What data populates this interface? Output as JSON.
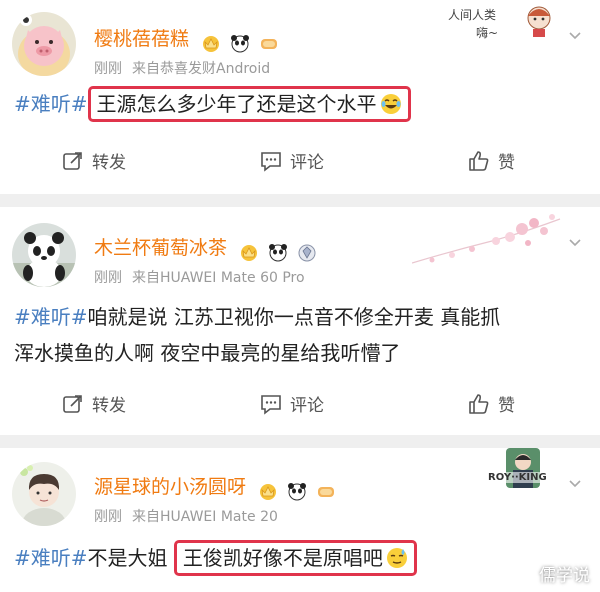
{
  "posts": [
    {
      "username": "樱桃蓓蓓糕",
      "time": "刚刚",
      "source": "来自恭喜发财Android",
      "content": {
        "hashtag": "#难听#",
        "highlight": "王源怎么多少年了还是这个水平",
        "emoji": "laugh-cry-emoji"
      },
      "decoration_text": [
        "人间人类",
        "嗨~"
      ],
      "actions": {
        "repost": "转发",
        "comment": "评论",
        "like": "赞"
      }
    },
    {
      "username": "木兰杯葡萄冰茶",
      "time": "刚刚",
      "source": "来自HUAWEI Mate 60 Pro",
      "content": {
        "hashtag": "#难听#",
        "line1": "咱就是说 江苏卫视你一点音不修全开麦 真能抓",
        "line2": "浑水摸鱼的人啊 夜空中最亮的星给我听懵了"
      },
      "actions": {
        "repost": "转发",
        "comment": "评论",
        "like": "赞"
      }
    },
    {
      "username": "源星球的小汤圆呀",
      "time": "刚刚",
      "source": "来自HUAWEI Mate 20",
      "content": {
        "hashtag": "#难听#",
        "plain": "不是大姐",
        "highlight": "王俊凯好像不是原唱吧",
        "emoji": "sweat-emoji"
      },
      "decoration_text": "ROY··KING"
    }
  ],
  "watermark": "儒学说",
  "colors": {
    "username": "#f07b12",
    "hashtag": "#4a7fc0",
    "highlight_border": "#e0344b",
    "meta": "#9a9a9a",
    "background": "#efefef"
  }
}
